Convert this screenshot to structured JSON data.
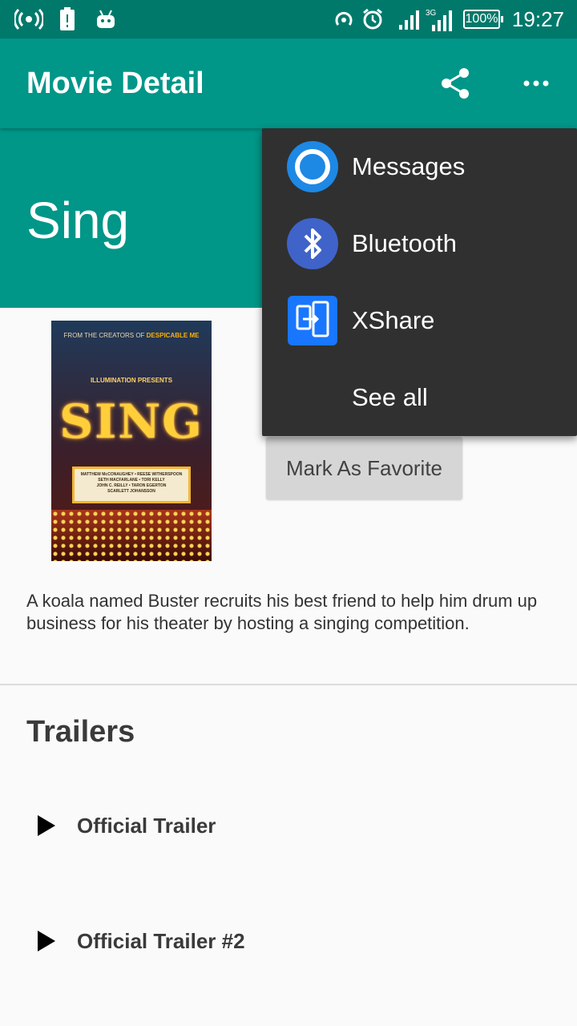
{
  "status_bar": {
    "time": "19:27",
    "battery": "100%",
    "network": "3G",
    "icons": [
      "hotspot-icon",
      "battery-alert-icon",
      "android-icon",
      "cast-icon",
      "alarm-icon",
      "signal-icon",
      "signal-3g-icon"
    ]
  },
  "app_bar": {
    "title": "Movie Detail",
    "icons": [
      "share-icon",
      "more-vert-icon"
    ]
  },
  "movie": {
    "title": "Sing",
    "overview": "A koala named Buster recruits his best friend to help him drum up business for his theater by hosting a singing competition.",
    "poster": {
      "tagline_prefix": "FROM THE CREATORS OF ",
      "tagline_highlight": "DESPICABLE ME",
      "brand": "ILLUMINATION PRESENTS",
      "logo_text": "SING",
      "marquee_lines": [
        "MATTHEW McCONAUGHEY • REESE WITHERSPOON",
        "SETH MACFARLANE • TORI KELLY",
        "JOHN C. REILLY • TARON EGERTON",
        "SCARLETT JOHANSSON"
      ]
    }
  },
  "favorite_button": {
    "label": "Mark As Favorite"
  },
  "trailers": {
    "heading": "Trailers",
    "items": [
      {
        "label": "Official Trailer"
      },
      {
        "label": "Official Trailer #2"
      }
    ]
  },
  "share_menu": {
    "items": [
      {
        "label": "Messages",
        "icon": "messages-icon"
      },
      {
        "label": "Bluetooth",
        "icon": "bluetooth-icon"
      },
      {
        "label": "XShare",
        "icon": "xshare-icon"
      },
      {
        "label": "See all"
      }
    ]
  },
  "colors": {
    "primary": "#009688",
    "primary_dark": "#00796b",
    "menu_bg": "#303030",
    "button_bg": "#d6d6d6"
  }
}
